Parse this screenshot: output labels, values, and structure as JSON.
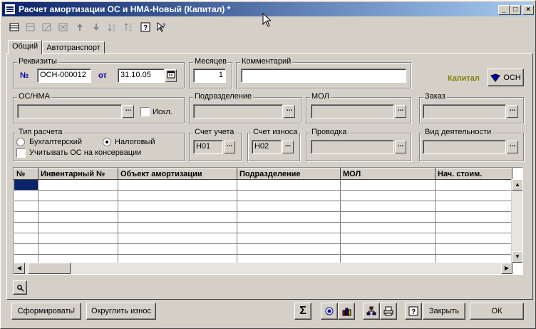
{
  "window": {
    "title": "Расчет амортизации ОС и НМА-Новый (Капитал) *"
  },
  "tabs": [
    {
      "label": "Общий"
    },
    {
      "label": "Автотранспорт"
    }
  ],
  "requisites": {
    "group_label": "Реквизиты",
    "number_label": "№",
    "number_value": "ОСН-000012",
    "date_label": "от",
    "date_value": "31.10.05"
  },
  "months": {
    "label": "Месяцев",
    "value": "1"
  },
  "comment": {
    "label": "Комментарий",
    "value": ""
  },
  "kapital": {
    "label": "Капитал",
    "button_label": "ОСН"
  },
  "os_nma": {
    "label": "ОС/НМА",
    "value": "",
    "exclude_label": "Искл."
  },
  "subdivision": {
    "label": "Подразделение",
    "value": ""
  },
  "mol": {
    "label": "МОЛ",
    "value": ""
  },
  "order": {
    "label": "Заказ",
    "value": ""
  },
  "calc_type": {
    "label": "Тип расчета",
    "option_accounting": "Бухгалтерский",
    "option_tax": "Налоговый",
    "selected": "Налоговый",
    "conservation_label": "Учитывать ОС на консервации"
  },
  "account": {
    "label": "Счет учета",
    "value": "Н01"
  },
  "depreciation_account": {
    "label": "Счет износа",
    "value": "Н02"
  },
  "posting": {
    "label": "Проводка",
    "value": ""
  },
  "activity": {
    "label": "Вид деятельности",
    "value": ""
  },
  "table": {
    "columns": [
      "№",
      "Инвентарный №",
      "Объект амортизации",
      "Подразделение",
      "МОЛ",
      "Нач. стоим."
    ],
    "row_count": 8
  },
  "buttons": {
    "form": "Сформировать!",
    "round": "Округлить износ",
    "close": "Закрыть",
    "ok": "ОК"
  },
  "colors": {
    "accent": "#0a246a",
    "kapital": "#808000"
  }
}
